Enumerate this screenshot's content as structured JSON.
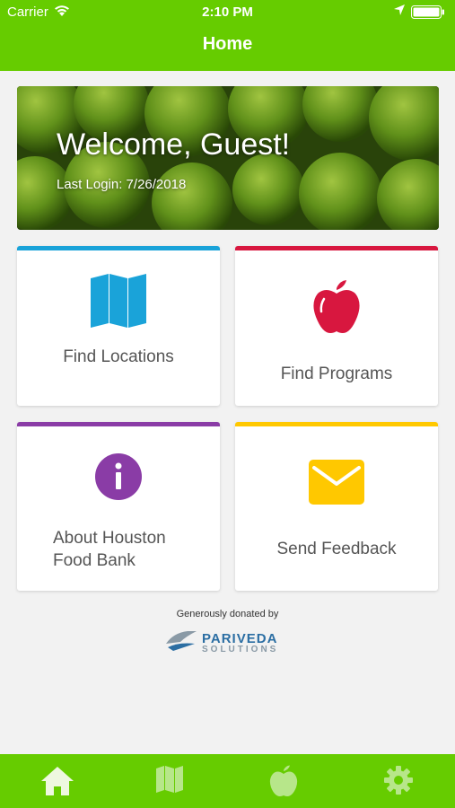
{
  "status_bar": {
    "carrier": "Carrier",
    "time": "2:10 PM",
    "icons": [
      "wifi-icon",
      "location-arrow-icon",
      "battery-icon"
    ]
  },
  "nav": {
    "title": "Home"
  },
  "hero": {
    "welcome": "Welcome, Guest!",
    "last_login": "Last Login: 7/26/2018"
  },
  "cards": [
    {
      "label": "Find Locations",
      "icon": "map-icon",
      "accent": "#1aa3d9"
    },
    {
      "label": "Find Programs",
      "icon": "apple-icon",
      "accent": "#d8173f"
    },
    {
      "label": "About Houston\nFood Bank",
      "icon": "info-icon",
      "accent": "#8a3ca6"
    },
    {
      "label": "Send Feedback",
      "icon": "envelope-icon",
      "accent": "#ffc800"
    }
  ],
  "footer": {
    "donated_text": "Generously donated by",
    "logo_name": "PARIVEDA",
    "logo_sub": "SOLUTIONS"
  },
  "tabbar": {
    "tabs": [
      "home-icon",
      "map-icon",
      "apple-icon",
      "gear-icon"
    ]
  },
  "colors": {
    "brand_green": "#66cc00",
    "background": "#f2f2f2"
  }
}
